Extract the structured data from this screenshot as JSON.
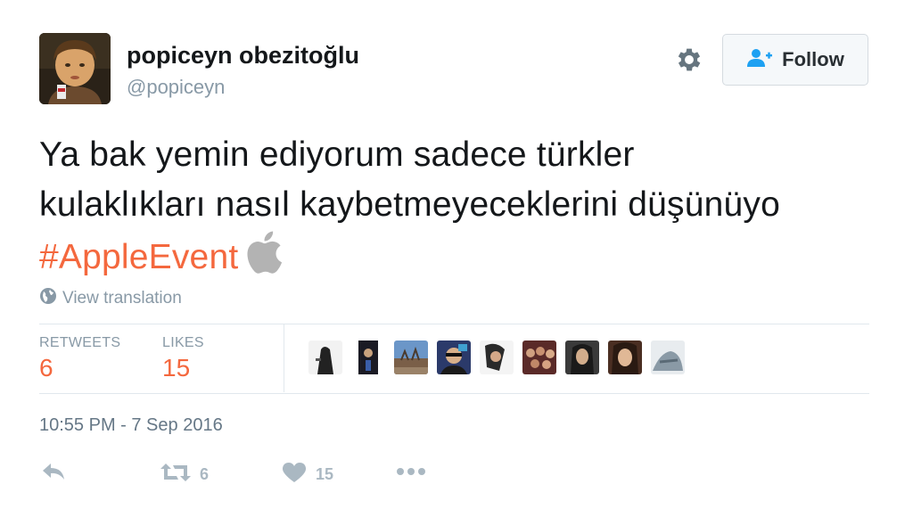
{
  "user": {
    "display_name": "popiceyn obezitoğlu",
    "handle": "@popiceyn"
  },
  "follow_button": {
    "label": "Follow"
  },
  "tweet": {
    "text_line1": "Ya bak yemin ediyorum sadece türkler",
    "text_line2": "kulaklıkları nasıl kaybetmeyeceklerini düşünüyo",
    "hashtag": "#AppleEvent"
  },
  "translation_link": "View translation",
  "stats": {
    "retweets_label": "RETWEETS",
    "retweets_count": "6",
    "likes_label": "LIKES",
    "likes_count": "15"
  },
  "timestamp": "10:55 PM - 7 Sep 2016",
  "actions": {
    "retweet_count": "6",
    "like_count": "15"
  },
  "colors": {
    "hashtag": "#f4683e",
    "stat_value": "#f4683e",
    "follow_icon": "#1da1f2",
    "muted": "#8899a6"
  },
  "icons": [
    "gear-icon",
    "follow-user-icon",
    "apple-logo",
    "globe-icon",
    "reply-icon",
    "retweet-icon",
    "heart-icon",
    "more-icon"
  ]
}
